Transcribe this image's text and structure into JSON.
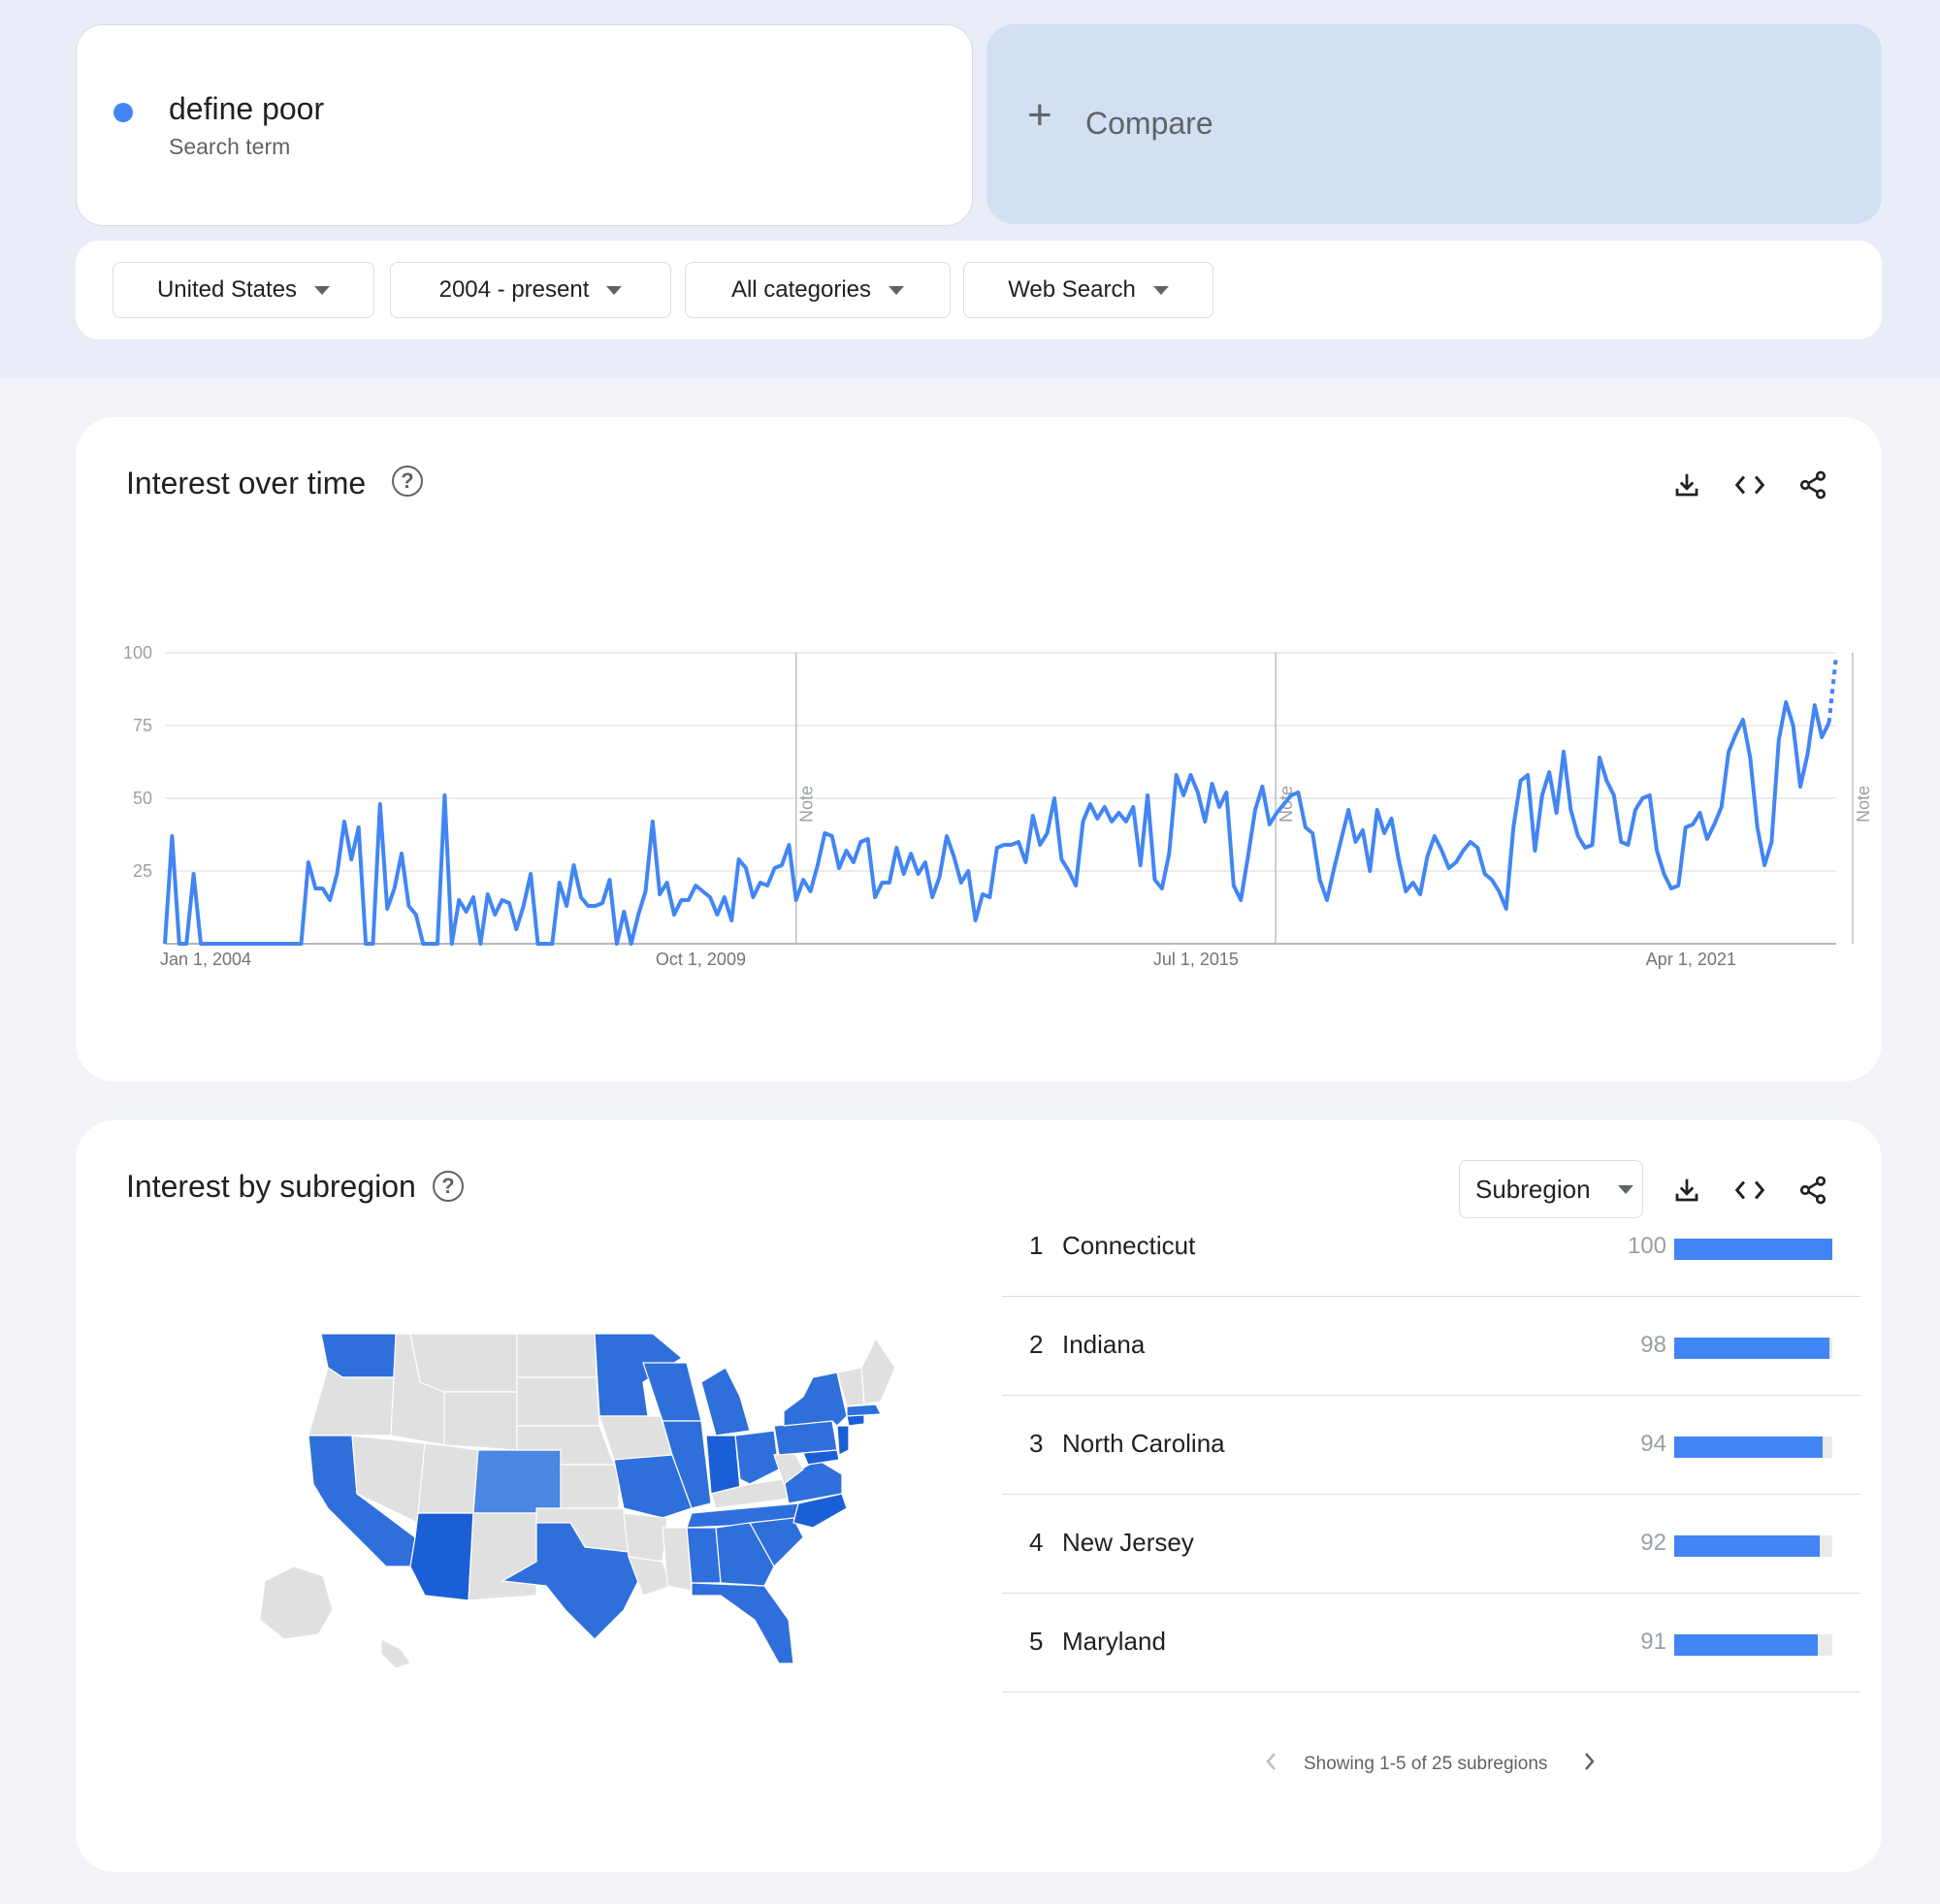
{
  "search": {
    "term": "define poor",
    "term_subtitle": "Search term",
    "term_color": "#4285f4",
    "compare_label": "Compare"
  },
  "filters": [
    {
      "label": "United States"
    },
    {
      "label": "2004 - present"
    },
    {
      "label": "All categories"
    },
    {
      "label": "Web Search"
    }
  ],
  "interest_over_time": {
    "title": "Interest over time",
    "note_label": "Note"
  },
  "chart_data": {
    "type": "line",
    "title": "Interest over time",
    "xlabel": "",
    "ylabel": "",
    "ylim": [
      0,
      100
    ],
    "yticks": [
      25,
      50,
      75,
      100
    ],
    "xticks": [
      "Jan 1, 2004",
      "Oct 1, 2009",
      "Jul 1, 2015",
      "Apr 1, 2021"
    ],
    "grid": true,
    "line_color": "#4285f4",
    "notes_at_year": [
      2011.33,
      2016.9,
      2023.6
    ],
    "series": [
      {
        "x_start_year": 2004.0,
        "x_step_year": 0.0833,
        "partial_last_point": true,
        "values": [
          0,
          37,
          0,
          0,
          24,
          0,
          0,
          0,
          0,
          0,
          0,
          0,
          0,
          0,
          0,
          0,
          0,
          0,
          0,
          0,
          28,
          19,
          19,
          15,
          24,
          42,
          29,
          40,
          0,
          0,
          48,
          12,
          19,
          31,
          13,
          10,
          0,
          0,
          0,
          51,
          0,
          15,
          11,
          16,
          0,
          17,
          10,
          15,
          14,
          5,
          13,
          24,
          0,
          0,
          0,
          21,
          13,
          27,
          16,
          13,
          13,
          14,
          22,
          0,
          11,
          0,
          10,
          18,
          42,
          17,
          21,
          10,
          15,
          15,
          20,
          18,
          16,
          10,
          16,
          8,
          29,
          26,
          16,
          21,
          20,
          26,
          27,
          34,
          15,
          22,
          18,
          27,
          38,
          37,
          26,
          32,
          28,
          35,
          36,
          16,
          21,
          21,
          33,
          24,
          31,
          24,
          28,
          16,
          23,
          37,
          30,
          21,
          25,
          8,
          17,
          16,
          33,
          34,
          34,
          35,
          28,
          44,
          34,
          38,
          50,
          29,
          25,
          20,
          42,
          48,
          43,
          47,
          42,
          45,
          42,
          47,
          27,
          51,
          22,
          19,
          31,
          58,
          51,
          58,
          52,
          42,
          55,
          47,
          52,
          20,
          15,
          30,
          46,
          54,
          41,
          45,
          48,
          51,
          52,
          40,
          38,
          22,
          15,
          26,
          36,
          46,
          35,
          39,
          25,
          46,
          38,
          43,
          29,
          18,
          21,
          17,
          30,
          37,
          32,
          26,
          28,
          32,
          35,
          33,
          24,
          22,
          18,
          12,
          40,
          56,
          58,
          32,
          51,
          59,
          45,
          66,
          46,
          37,
          33,
          34,
          64,
          56,
          51,
          35,
          34,
          46,
          50,
          51,
          32,
          24,
          19,
          20,
          40,
          41,
          45,
          36,
          41,
          47,
          66,
          72,
          77,
          64,
          40,
          27,
          35,
          70,
          83,
          75,
          54,
          65,
          82,
          71,
          76,
          99
        ]
      }
    ]
  },
  "interest_by_subregion": {
    "title": "Interest by subregion",
    "select_label": "Subregion",
    "rows": [
      {
        "rank": "1",
        "name": "Connecticut",
        "value": "100",
        "fraction": 1.0
      },
      {
        "rank": "2",
        "name": "Indiana",
        "value": "98",
        "fraction": 0.98
      },
      {
        "rank": "3",
        "name": "North Carolina",
        "value": "94",
        "fraction": 0.94
      },
      {
        "rank": "4",
        "name": "New Jersey",
        "value": "92",
        "fraction": 0.92
      },
      {
        "rank": "5",
        "name": "Maryland",
        "value": "91",
        "fraction": 0.91
      }
    ],
    "pagination_text": "Showing 1-5 of 25 subregions"
  },
  "colors": {
    "primary": "#4285f4",
    "map_strong": "#1a5fd6",
    "map_medium": "#2f6fdc",
    "map_light": "#4a86e3",
    "map_none": "#e0e0e0"
  },
  "icons": [
    "help-icon",
    "download-icon",
    "embed-icon",
    "share-icon",
    "chevron-left-icon",
    "chevron-right-icon",
    "plus-icon",
    "caret-down-icon"
  ]
}
